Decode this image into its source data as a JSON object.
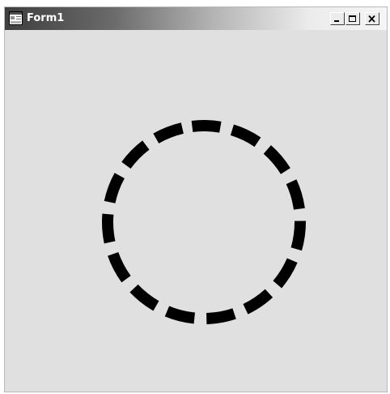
{
  "window": {
    "title": "Form1"
  },
  "titlebar": {
    "icon": "form-app-icon",
    "buttons": [
      {
        "name": "minimize",
        "icon": "minimize-icon"
      },
      {
        "name": "maximize",
        "icon": "maximize-icon"
      },
      {
        "name": "close",
        "icon": "close-icon"
      }
    ]
  },
  "canvas": {
    "shape": "circle",
    "stroke_style": "dashed",
    "stroke_color": "#000000",
    "background": "#e0e0e0"
  }
}
